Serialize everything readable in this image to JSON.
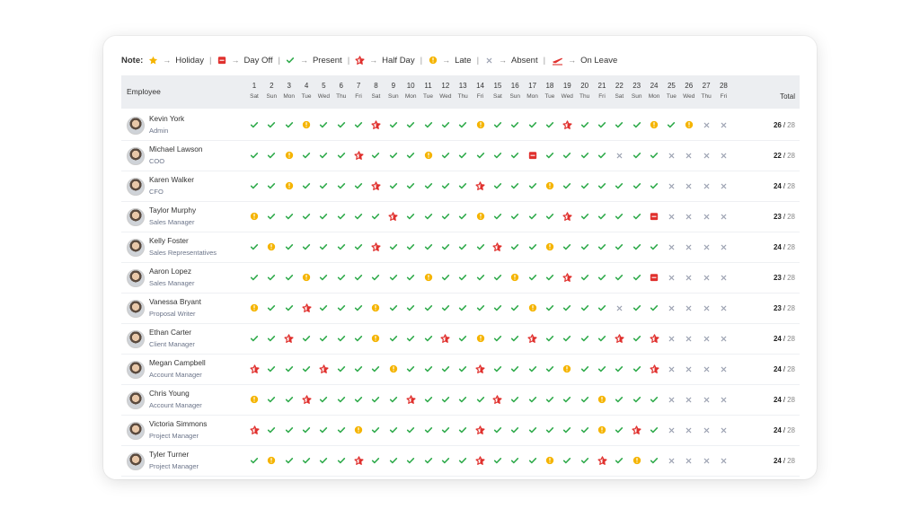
{
  "legend": {
    "label": "Note:",
    "items": [
      {
        "icon": "holiday-star-icon",
        "text": "Holiday"
      },
      {
        "icon": "day-off-calendar-icon",
        "text": "Day Off"
      },
      {
        "icon": "present-check-icon",
        "text": "Present"
      },
      {
        "icon": "half-day-star-icon",
        "text": "Half Day"
      },
      {
        "icon": "late-clock-icon",
        "text": "Late"
      },
      {
        "icon": "absent-cross-icon",
        "text": "Absent"
      },
      {
        "icon": "on-leave-plane-icon",
        "text": "On Leave"
      }
    ]
  },
  "header": {
    "employee": "Employee",
    "total": "Total",
    "days": [
      {
        "n": "1",
        "d": "Sat"
      },
      {
        "n": "2",
        "d": "Sun"
      },
      {
        "n": "3",
        "d": "Mon"
      },
      {
        "n": "4",
        "d": "Tue"
      },
      {
        "n": "5",
        "d": "Wed"
      },
      {
        "n": "6",
        "d": "Thu"
      },
      {
        "n": "7",
        "d": "Fri"
      },
      {
        "n": "8",
        "d": "Sat"
      },
      {
        "n": "9",
        "d": "Sun"
      },
      {
        "n": "10",
        "d": "Mon"
      },
      {
        "n": "11",
        "d": "Tue"
      },
      {
        "n": "12",
        "d": "Wed"
      },
      {
        "n": "13",
        "d": "Thu"
      },
      {
        "n": "14",
        "d": "Fri"
      },
      {
        "n": "15",
        "d": "Sat"
      },
      {
        "n": "16",
        "d": "Sun"
      },
      {
        "n": "17",
        "d": "Mon"
      },
      {
        "n": "18",
        "d": "Tue"
      },
      {
        "n": "19",
        "d": "Wed"
      },
      {
        "n": "20",
        "d": "Thu"
      },
      {
        "n": "21",
        "d": "Fri"
      },
      {
        "n": "22",
        "d": "Sat"
      },
      {
        "n": "23",
        "d": "Sun"
      },
      {
        "n": "24",
        "d": "Mon"
      },
      {
        "n": "25",
        "d": "Tue"
      },
      {
        "n": "26",
        "d": "Wed"
      },
      {
        "n": "27",
        "d": "Thu"
      },
      {
        "n": "28",
        "d": "Fri"
      }
    ]
  },
  "colors": {
    "present": "#2eaa4a",
    "late": "#f5b400",
    "half": "#e0312e",
    "dayoff": "#e0312e",
    "absent": "#9aa0b0"
  },
  "employees": [
    {
      "name": "Kevin York",
      "role": "Admin",
      "present": "26",
      "total": "28",
      "att": [
        "P",
        "P",
        "P",
        "L",
        "P",
        "P",
        "P",
        "H",
        "P",
        "P",
        "P",
        "P",
        "P",
        "L",
        "P",
        "P",
        "P",
        "P",
        "H",
        "P",
        "P",
        "P",
        "P",
        "L",
        "P",
        "L",
        "A",
        "A"
      ]
    },
    {
      "name": "Michael Lawson",
      "role": "COO",
      "present": "22",
      "total": "28",
      "att": [
        "P",
        "P",
        "L",
        "P",
        "P",
        "P",
        "H",
        "P",
        "P",
        "P",
        "L",
        "P",
        "P",
        "P",
        "P",
        "P",
        "O",
        "P",
        "P",
        "P",
        "P",
        "A",
        "P",
        "P",
        "A",
        "A",
        "A",
        "A"
      ]
    },
    {
      "name": "Karen Walker",
      "role": "CFO",
      "present": "24",
      "total": "28",
      "att": [
        "P",
        "P",
        "L",
        "P",
        "P",
        "P",
        "P",
        "H",
        "P",
        "P",
        "P",
        "P",
        "P",
        "H",
        "P",
        "P",
        "P",
        "L",
        "P",
        "P",
        "P",
        "P",
        "P",
        "P",
        "A",
        "A",
        "A",
        "A"
      ]
    },
    {
      "name": "Taylor Murphy",
      "role": "Sales Manager",
      "present": "23",
      "total": "28",
      "att": [
        "L",
        "P",
        "P",
        "P",
        "P",
        "P",
        "P",
        "P",
        "H",
        "P",
        "P",
        "P",
        "P",
        "L",
        "P",
        "P",
        "P",
        "P",
        "H",
        "P",
        "P",
        "P",
        "P",
        "O",
        "A",
        "A",
        "A",
        "A"
      ]
    },
    {
      "name": "Kelly Foster",
      "role": "Sales Representatives",
      "present": "24",
      "total": "28",
      "att": [
        "P",
        "L",
        "P",
        "P",
        "P",
        "P",
        "P",
        "H",
        "P",
        "P",
        "P",
        "P",
        "P",
        "P",
        "H",
        "P",
        "P",
        "L",
        "P",
        "P",
        "P",
        "P",
        "P",
        "P",
        "A",
        "A",
        "A",
        "A"
      ]
    },
    {
      "name": "Aaron Lopez",
      "role": "Sales Manager",
      "present": "23",
      "total": "28",
      "att": [
        "P",
        "P",
        "P",
        "L",
        "P",
        "P",
        "P",
        "P",
        "P",
        "P",
        "L",
        "P",
        "P",
        "P",
        "P",
        "L",
        "P",
        "P",
        "H",
        "P",
        "P",
        "P",
        "P",
        "O",
        "A",
        "A",
        "A",
        "A"
      ]
    },
    {
      "name": "Vanessa Bryant",
      "role": "Proposal Writer",
      "present": "23",
      "total": "28",
      "att": [
        "L",
        "P",
        "P",
        "H",
        "P",
        "P",
        "P",
        "L",
        "P",
        "P",
        "P",
        "P",
        "P",
        "P",
        "P",
        "P",
        "L",
        "P",
        "P",
        "P",
        "P",
        "A",
        "P",
        "P",
        "A",
        "A",
        "A",
        "A"
      ]
    },
    {
      "name": "Ethan Carter",
      "role": "Client Manager",
      "present": "24",
      "total": "28",
      "att": [
        "P",
        "P",
        "H",
        "P",
        "P",
        "P",
        "P",
        "L",
        "P",
        "P",
        "P",
        "H",
        "P",
        "L",
        "P",
        "P",
        "H",
        "P",
        "P",
        "P",
        "P",
        "H",
        "P",
        "H",
        "A",
        "A",
        "A",
        "A"
      ]
    },
    {
      "name": "Megan Campbell",
      "role": "Account Manager",
      "present": "24",
      "total": "28",
      "att": [
        "H",
        "P",
        "P",
        "P",
        "H",
        "P",
        "P",
        "P",
        "L",
        "P",
        "P",
        "P",
        "P",
        "H",
        "P",
        "P",
        "P",
        "P",
        "L",
        "P",
        "P",
        "P",
        "P",
        "H",
        "A",
        "A",
        "A",
        "A"
      ]
    },
    {
      "name": "Chris Young",
      "role": "Account Manager",
      "present": "24",
      "total": "28",
      "att": [
        "L",
        "P",
        "P",
        "H",
        "P",
        "P",
        "P",
        "P",
        "P",
        "H",
        "P",
        "P",
        "P",
        "P",
        "H",
        "P",
        "P",
        "P",
        "P",
        "P",
        "L",
        "P",
        "P",
        "P",
        "A",
        "A",
        "A",
        "A"
      ]
    },
    {
      "name": "Victoria Simmons",
      "role": "Project Manager",
      "present": "24",
      "total": "28",
      "att": [
        "H",
        "P",
        "P",
        "P",
        "P",
        "P",
        "L",
        "P",
        "P",
        "P",
        "P",
        "P",
        "P",
        "H",
        "P",
        "P",
        "P",
        "P",
        "P",
        "P",
        "L",
        "P",
        "H",
        "P",
        "A",
        "A",
        "A",
        "A"
      ]
    },
    {
      "name": "Tyler Turner",
      "role": "Project Manager",
      "present": "24",
      "total": "28",
      "att": [
        "P",
        "L",
        "P",
        "P",
        "P",
        "P",
        "H",
        "P",
        "P",
        "P",
        "P",
        "P",
        "P",
        "H",
        "P",
        "P",
        "P",
        "L",
        "P",
        "P",
        "H",
        "P",
        "L",
        "P",
        "A",
        "A",
        "A",
        "A"
      ]
    }
  ]
}
